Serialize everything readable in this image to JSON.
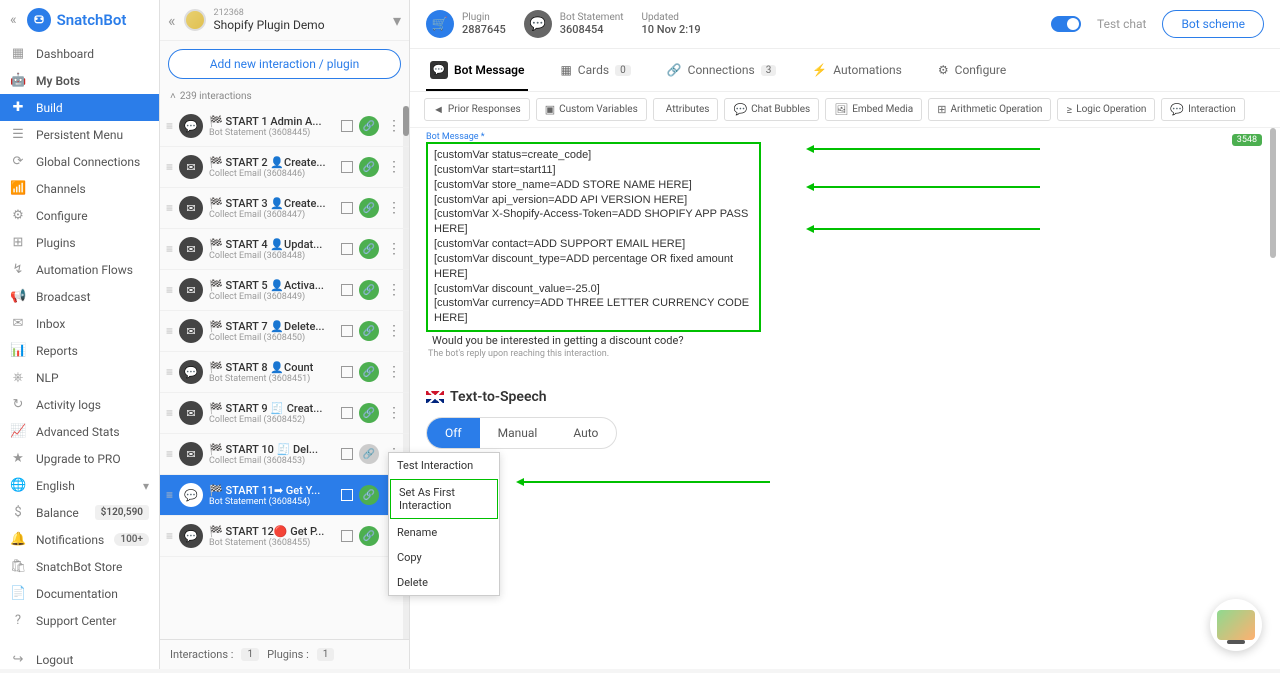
{
  "brand": "SnatchBot",
  "sidebar": {
    "items": [
      {
        "icon": "▦",
        "label": "Dashboard"
      },
      {
        "icon": "🤖",
        "label": "My Bots",
        "bold": true
      },
      {
        "icon": "✚",
        "label": "Build",
        "active": true
      },
      {
        "icon": "☰",
        "label": "Persistent Menu"
      },
      {
        "icon": "⟳",
        "label": "Global Connections"
      },
      {
        "icon": "📶",
        "label": "Channels"
      },
      {
        "icon": "⚙",
        "label": "Configure"
      }
    ],
    "secondary": [
      {
        "icon": "⊞",
        "label": "Plugins"
      },
      {
        "icon": "↯",
        "label": "Automation Flows"
      },
      {
        "icon": "📢",
        "label": "Broadcast"
      },
      {
        "icon": "✉",
        "label": "Inbox"
      },
      {
        "icon": "📊",
        "label": "Reports"
      },
      {
        "icon": "⎈",
        "label": "NLP"
      },
      {
        "icon": "↻",
        "label": "Activity logs"
      },
      {
        "icon": "📈",
        "label": "Advanced Stats"
      },
      {
        "icon": "★",
        "label": "Upgrade to PRO"
      }
    ],
    "tertiary": [
      {
        "icon": "🌐",
        "label": "English",
        "chevron": true
      },
      {
        "icon": "$",
        "label": "Balance",
        "pill": "$120,590"
      },
      {
        "icon": "🔔",
        "label": "Notifications",
        "pill": "100+"
      },
      {
        "icon": "🛍",
        "label": "SnatchBot Store"
      },
      {
        "icon": "📄",
        "label": "Documentation"
      },
      {
        "icon": "?",
        "label": "Support Center"
      }
    ],
    "logout": {
      "icon": "↪",
      "label": "Logout"
    }
  },
  "bot": {
    "id": "212368",
    "name": "Shopify Plugin Demo"
  },
  "add_new": "Add new interaction / plugin",
  "int_count_label": "239 interactions",
  "interactions": [
    {
      "icon": "💬",
      "title": "🏁 START 1 Admin A...",
      "sub": "Bot Statement (3608445)"
    },
    {
      "icon": "✉",
      "title": "🏁 START 2 👤Create...",
      "sub": "Collect Email (3608446)"
    },
    {
      "icon": "✉",
      "title": "🏁 START 3 👤Create...",
      "sub": "Collect Email (3608447)"
    },
    {
      "icon": "✉",
      "title": "🏁 START 4 👤Updat...",
      "sub": "Collect Email (3608448)"
    },
    {
      "icon": "✉",
      "title": "🏁 START 5 👤Activa...",
      "sub": "Collect Email (3608449)"
    },
    {
      "icon": "✉",
      "title": "🏁 START 7 👤Delete...",
      "sub": "Collect Email (3608450)"
    },
    {
      "icon": "💬",
      "title": "🏁 START 8 👤Count",
      "sub": "Bot Statement (3608451)"
    },
    {
      "icon": "✉",
      "title": "🏁 START 9 🧾 Creat...",
      "sub": "Collect Email (3608452)"
    },
    {
      "icon": "✉",
      "title": "🏁 START 10 🧾 Del...",
      "sub": "Collect Email (3608453)",
      "dim": true
    },
    {
      "icon": "💬",
      "title": "🏁 START 11➡ Get Y...",
      "sub": "Bot Statement (3608454)",
      "selected": true
    },
    {
      "icon": "💬",
      "title": "🏁 START 12🔴 Get P...",
      "sub": "Bot Statement (3608455)"
    }
  ],
  "mid_footer": {
    "int_lbl": "Interactions :",
    "int_n": "1",
    "plg_lbl": "Plugins :",
    "plg_n": "1"
  },
  "ctx": [
    "Test Interaction",
    "Set As First Interaction",
    "Rename",
    "Copy",
    "Delete"
  ],
  "top": {
    "plugin_lbl": "Plugin",
    "plugin_val": "2887645",
    "bs_lbl": "Bot Statement",
    "bs_val": "3608454",
    "upd_lbl": "Updated",
    "upd_val": "10 Nov 2:19",
    "test_chat": "Test chat",
    "scheme": "Bot scheme"
  },
  "tabs": {
    "bot_msg": "Bot Message",
    "cards": "Cards",
    "cards_n": "0",
    "conn": "Connections",
    "conn_n": "3",
    "auto": "Automations",
    "conf": "Configure"
  },
  "tools": [
    "Prior Responses",
    "Custom Variables",
    "Attributes",
    "Chat Bubbles",
    "Embed Media",
    "Arithmetic Operation",
    "Logic Operation",
    "Interaction"
  ],
  "tool_icons": [
    "◄",
    "▣",
    "</>",
    "💬",
    "🖼",
    "⊞",
    "≥",
    "💬"
  ],
  "msg": {
    "label": "Bot Message *",
    "lines": [
      "[customVar status=create_code]",
      "[customVar start=start11]",
      "[customVar store_name=ADD STORE NAME HERE]",
      "[customVar api_version=ADD API VERSION HERE]",
      "[customVar X-Shopify-Access-Token=ADD SHOPIFY APP PASS HERE]",
      "[customVar contact=ADD SUPPORT EMAIL HERE]",
      "[customVar discount_type=ADD percentage OR fixed amount HERE]",
      "[customVar discount_value=-25.0]",
      "[customVar currency=ADD THREE LETTER CURRENCY CODE HERE]"
    ],
    "extra": "Would you be interested in getting a discount code?",
    "help": "The bot's reply upon reaching this interaction.",
    "count": "3548"
  },
  "tts": {
    "title": "Text-to-Speech",
    "off": "Off",
    "manual": "Manual",
    "auto": "Auto"
  }
}
